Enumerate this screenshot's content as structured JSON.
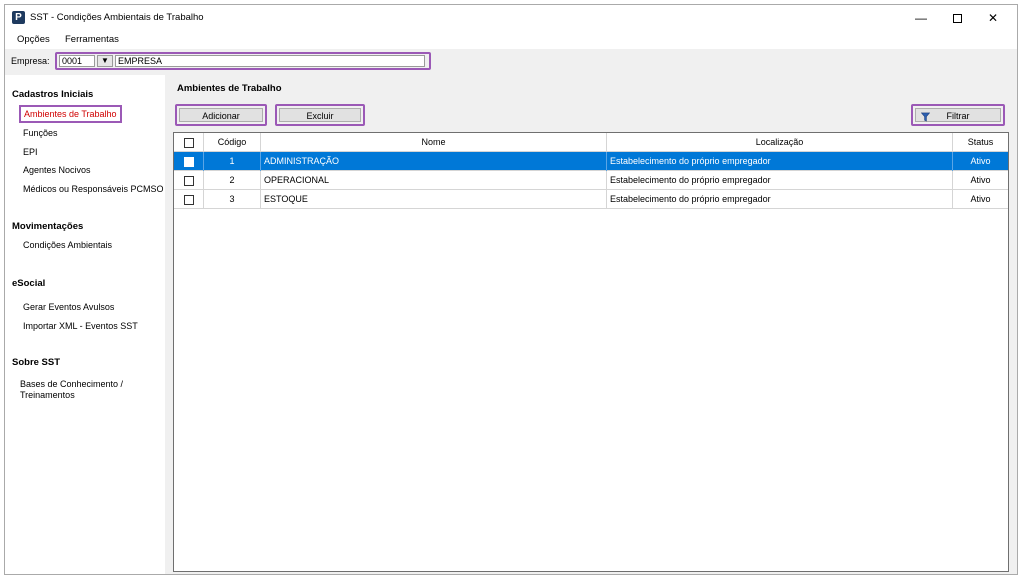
{
  "window": {
    "app_icon": "P",
    "title": "SST - Condições Ambientais de Trabalho",
    "minimize": "—",
    "close": "✕"
  },
  "menu": [
    "Opções",
    "Ferramentas"
  ],
  "empresa": {
    "label": "Empresa:",
    "code": "0001",
    "dropdown": "▼",
    "name": "EMPRESA"
  },
  "sidebar": {
    "cadastros": {
      "title": "Cadastros Iniciais",
      "items": [
        "Ambientes de Trabalho",
        "Funções",
        "EPI",
        "Agentes Nocivos",
        "Médicos ou Responsáveis PCMSO"
      ]
    },
    "movimentacoes": {
      "title": "Movimentações",
      "items": [
        "Condições Ambientais"
      ]
    },
    "esocial": {
      "title": "eSocial",
      "items": [
        "Gerar Eventos Avulsos",
        "Importar XML - Eventos SST"
      ]
    },
    "sobre": {
      "title": "Sobre SST",
      "items": [
        "Bases de Conhecimento /",
        "Treinamentos"
      ]
    }
  },
  "main": {
    "title": "Ambientes de Trabalho",
    "add_label": "Adicionar",
    "delete_label": "Excluir",
    "filter_label": "Filtrar"
  },
  "table": {
    "columns": [
      "Código",
      "Nome",
      "Localização",
      "Status"
    ],
    "rows": [
      {
        "codigo": "1",
        "nome": "ADMINISTRAÇÃO",
        "localizacao": "Estabelecimento do próprio empregador",
        "status": "Ativo"
      },
      {
        "codigo": "2",
        "nome": "OPERACIONAL",
        "localizacao": "Estabelecimento do próprio empregador",
        "status": "Ativo"
      },
      {
        "codigo": "3",
        "nome": "ESTOQUE",
        "localizacao": "Estabelecimento do próprio empregador",
        "status": "Ativo"
      }
    ]
  },
  "colors": {
    "selection": "#0078d7",
    "highlight": "#9b59b6",
    "active_nav": "#d00000"
  }
}
